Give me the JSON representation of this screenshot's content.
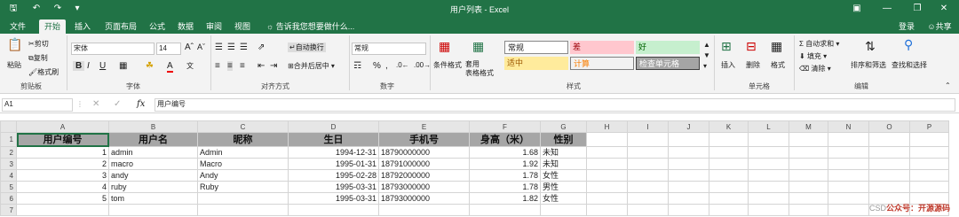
{
  "window": {
    "title": "用户列表 - Excel",
    "login": "登录",
    "share": "共享"
  },
  "tabs": [
    "文件",
    "开始",
    "插入",
    "页面布局",
    "公式",
    "数据",
    "审阅",
    "视图"
  ],
  "tellme": "告诉我您想要做什么...",
  "ribbon": {
    "clipboard": {
      "paste": "粘贴",
      "cut": "剪切",
      "copy": "复制",
      "format_painter": "格式刷",
      "label": "剪贴板"
    },
    "font": {
      "name": "宋体",
      "size": "14",
      "label": "字体"
    },
    "alignment": {
      "wrap": "自动换行",
      "merge": "合并后居中",
      "label": "对齐方式"
    },
    "number": {
      "format": "常规",
      "label": "数字"
    },
    "styles": {
      "conditional": "条件格式",
      "table_fmt": "套用\n表格格式",
      "normal": "常规",
      "bad": "差",
      "good": "好",
      "neutral": "适中",
      "calc": "计算",
      "check": "检查单元格",
      "label": "样式"
    },
    "cells": {
      "insert": "插入",
      "delete": "删除",
      "format": "格式",
      "label": "单元格"
    },
    "editing": {
      "autosum": "自动求和",
      "fill": "填充",
      "clear": "清除",
      "sort": "排序和筛选",
      "find": "查找和选择",
      "label": "编辑"
    }
  },
  "formula": {
    "name_box": "A1",
    "fx": "fx",
    "content": "用户编号"
  },
  "columns": [
    "A",
    "B",
    "C",
    "D",
    "E",
    "F",
    "G",
    "H",
    "I",
    "J",
    "K",
    "L",
    "M",
    "N",
    "O",
    "P"
  ],
  "header_row": [
    "用户编号",
    "用户名",
    "昵称",
    "生日",
    "手机号",
    "身高（米）",
    "性别"
  ],
  "rows": [
    [
      "1",
      "admin",
      "Admin",
      "1994-12-31",
      "18790000000",
      "1.68",
      "未知"
    ],
    [
      "2",
      "macro",
      "Macro",
      "1995-01-31",
      "18791000000",
      "1.92",
      "未知"
    ],
    [
      "3",
      "andy",
      "Andy",
      "1995-02-28",
      "18792000000",
      "1.78",
      "女性"
    ],
    [
      "4",
      "ruby",
      "Ruby",
      "1995-03-31",
      "18793000000",
      "1.78",
      "男性"
    ],
    [
      "5",
      "tom",
      "",
      "1995-03-31",
      "18793000000",
      "1.82",
      "女性"
    ],
    [
      "",
      "",
      "",
      "",
      "",
      "",
      ""
    ]
  ],
  "row_numbers": [
    "1",
    "2",
    "3",
    "4",
    "5",
    "6",
    "7"
  ],
  "watermark": {
    "prefix": "CSD",
    "text": "公众号：开源源码"
  },
  "colors": {
    "excel_green": "#217346",
    "header_fill": "#a6a6a6"
  }
}
